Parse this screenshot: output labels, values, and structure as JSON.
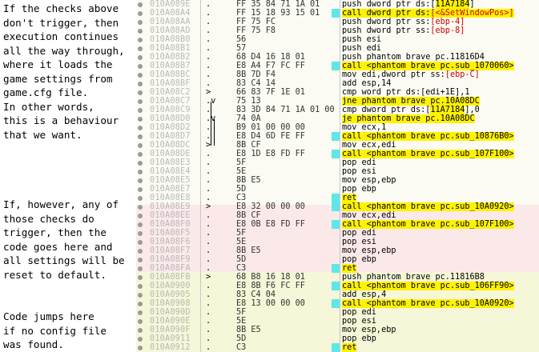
{
  "notes": [
    "If the checks above",
    "don't trigger, then",
    "execution continues",
    "all the way through,",
    "where it loads the",
    "game settings from",
    "game.cfg file.",
    "In other words,",
    "this is a behaviour",
    "that we want.",
    "",
    "",
    "",
    "",
    "If, however, any of",
    "those checks do",
    "trigger, then the",
    "code goes here and",
    "all settings will be",
    "reset to default.",
    "",
    "",
    "Code jumps here",
    "if no config file",
    "was found."
  ],
  "colors": {
    "band_default": "#fbfbf3",
    "band_red": "#fbe9ea",
    "band_yellow": "#f6f6d8",
    "highlight": "#fff200",
    "cyan_bar": "#5fe7e7",
    "address": "#b8b8b8"
  },
  "rows": [
    {
      "addr": "010A089E",
      "arrow": ".",
      "bytes": "FF 35 84 71 1A 01",
      "instr": "push dword ptr ds:[11A7184]",
      "hl": "ptr"
    },
    {
      "addr": "010A08A4",
      "arrow": ".",
      "bytes": "FF 15 18 93 15 01",
      "instr": "call dword ptr ds:[<&SetWindowPos>]",
      "hl": "call"
    },
    {
      "addr": "010A08AA",
      "arrow": ".",
      "bytes": "FF 75 FC",
      "instr": "push dword ptr ss:[ebp-4]",
      "hl": "reg"
    },
    {
      "addr": "010A08AD",
      "arrow": ".",
      "bytes": "FF 75 F8",
      "instr": "push dword ptr ss:[ebp-8]",
      "hl": "reg"
    },
    {
      "addr": "010A08B0",
      "arrow": ".",
      "bytes": "56",
      "instr": "push esi"
    },
    {
      "addr": "010A08B1",
      "arrow": ".",
      "bytes": "57",
      "instr": "push edi"
    },
    {
      "addr": "010A08B2",
      "arrow": ".",
      "bytes": "68 D4 16 18 01",
      "instr": "push phantom brave pc.11816D4"
    },
    {
      "addr": "010A08B7",
      "arrow": ".",
      "bytes": "E8 A4 F7 FC FF",
      "instr": "call <phantom brave pc.sub_1070060>",
      "hl": "call"
    },
    {
      "addr": "010A08BC",
      "arrow": ".",
      "bytes": "8B 7D F4",
      "instr": "mov edi,dword ptr ss:[ebp-C]",
      "hl": "reg"
    },
    {
      "addr": "010A08BF",
      "arrow": ".",
      "bytes": "83 C4 14",
      "instr": "add esp,14"
    },
    {
      "addr": "010A08C2",
      "arrow": ">",
      "bytes": "66 83 7F 1E 01",
      "instr": "cmp word ptr ds:[edi+1E],1"
    },
    {
      "addr": "010A08C7",
      "arrow": ".v",
      "bytes": "75 13",
      "instr": "jne phantom brave pc.10A08DC",
      "hl": "jmp"
    },
    {
      "addr": "010A08C9",
      "arrow": ".",
      "bytes": "83 3D 84 71 1A 01 00",
      "instr": "cmp dword ptr ds:[11A7184],0"
    },
    {
      "addr": "010A08D0",
      "arrow": ".v",
      "bytes": "74 0A",
      "instr": "je phantom brave pc.10A08DC",
      "hl": "jmp"
    },
    {
      "addr": "010A08D2",
      "arrow": ".",
      "bytes": "B9 01 00 00 00",
      "instr": "mov ecx,1"
    },
    {
      "addr": "010A08D7",
      "arrow": ".",
      "bytes": "E8 D4 6D FE FF",
      "instr": "call <phantom brave pc.sub_10876B0>",
      "hl": "call"
    },
    {
      "addr": "010A08DC",
      "arrow": ">",
      "bytes": "8B CF",
      "instr": "mov ecx,edi"
    },
    {
      "addr": "010A08DE",
      "arrow": ".",
      "bytes": "E8 1D E8 FD FF",
      "instr": "call <phantom brave pc.sub_107F100>",
      "hl": "call"
    },
    {
      "addr": "010A08E3",
      "arrow": ".",
      "bytes": "5F",
      "instr": "pop edi"
    },
    {
      "addr": "010A08E4",
      "arrow": ".",
      "bytes": "5E",
      "instr": "pop esi"
    },
    {
      "addr": "010A08E5",
      "arrow": ".",
      "bytes": "8B E5",
      "instr": "mov esp,ebp"
    },
    {
      "addr": "010A08E7",
      "arrow": ".",
      "bytes": "5D",
      "instr": "pop ebp"
    },
    {
      "addr": "010A08E8",
      "arrow": ".",
      "bytes": "C3",
      "instr": "ret",
      "hl": "ret"
    },
    {
      "addr": "010A08E9",
      "arrow": ">",
      "bytes": "E8 32 00 00 00",
      "instr": "call <phantom brave pc.sub_10A0920>",
      "hl": "call"
    },
    {
      "addr": "010A08EE",
      "arrow": ".",
      "bytes": "8B CF",
      "instr": "mov ecx,edi"
    },
    {
      "addr": "010A08F0",
      "arrow": ".",
      "bytes": "E8 0B E8 FD FF",
      "instr": "call <phantom brave pc.sub_107F100>",
      "hl": "call"
    },
    {
      "addr": "010A08F5",
      "arrow": ".",
      "bytes": "5F",
      "instr": "pop edi"
    },
    {
      "addr": "010A08F6",
      "arrow": ".",
      "bytes": "5E",
      "instr": "pop esi"
    },
    {
      "addr": "010A08F7",
      "arrow": ".",
      "bytes": "8B E5",
      "instr": "mov esp,ebp"
    },
    {
      "addr": "010A08F9",
      "arrow": ".",
      "bytes": "5D",
      "instr": "pop ebp"
    },
    {
      "addr": "010A08FA",
      "arrow": ".",
      "bytes": "C3",
      "instr": "ret",
      "hl": "ret"
    },
    {
      "addr": "010A08FB",
      "arrow": ">",
      "bytes": "68 B8 16 18 01",
      "instr": "push phantom brave pc.11816B8"
    },
    {
      "addr": "010A0900",
      "arrow": ".",
      "bytes": "E8 8B F6 FC FF",
      "instr": "call <phantom brave pc.sub_106FF90>",
      "hl": "call"
    },
    {
      "addr": "010A0905",
      "arrow": ".",
      "bytes": "83 C4 04",
      "instr": "add esp,4"
    },
    {
      "addr": "010A0908",
      "arrow": ".",
      "bytes": "E8 13 00 00 00",
      "instr": "call <phantom brave pc.sub_10A0920>",
      "hl": "call"
    },
    {
      "addr": "010A090D",
      "arrow": ".",
      "bytes": "5F",
      "instr": "pop edi"
    },
    {
      "addr": "010A090E",
      "arrow": ".",
      "bytes": "5E",
      "instr": "pop esi"
    },
    {
      "addr": "010A090F",
      "arrow": ".",
      "bytes": "8B E5",
      "instr": "mov esp,ebp"
    },
    {
      "addr": "010A0911",
      "arrow": ".",
      "bytes": "5D",
      "instr": "pop ebp"
    },
    {
      "addr": "010A0912",
      "arrow": ".",
      "bytes": "C3",
      "instr": "ret",
      "hl": "ret"
    }
  ]
}
